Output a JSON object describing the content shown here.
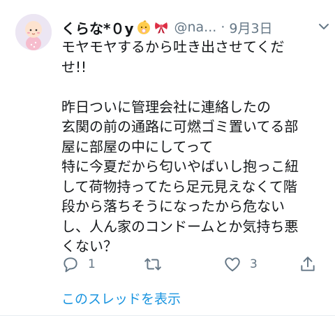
{
  "tweet": {
    "display_name": "くらな*０y",
    "handle": "@na...",
    "separator": "·",
    "date": "9月3日",
    "lines": [
      "モヤモヤするから吐き出させてくだ",
      "せ!!",
      "",
      "昨日ついに管理会社に連絡したの",
      "玄関の前の通路に可燃ゴミ置いてる部",
      "屋に部屋の中にしてって",
      "特に今夏だから匂いやばいし抱っこ紐",
      "して荷物持ってたら足元見えなくて階",
      "段から落ちそうになったから危ない",
      "し、人ん家のコンドームとか気持ち悪",
      "くない？"
    ],
    "reply_count": "1",
    "retweet_count": "",
    "like_count": "3",
    "thread_link": "このスレッドを表示"
  },
  "icons": {
    "badge1": "baby-emoji-icon",
    "badge2": "ribbon-emoji-icon",
    "menu": "chevron-down-icon",
    "reply": "reply-icon",
    "retweet": "retweet-icon",
    "like": "heart-icon",
    "share": "share-icon"
  },
  "colors": {
    "text": "#14171a",
    "secondary": "#657786",
    "link": "#1b95e0",
    "avatar_bg": "#e9e3f2"
  }
}
